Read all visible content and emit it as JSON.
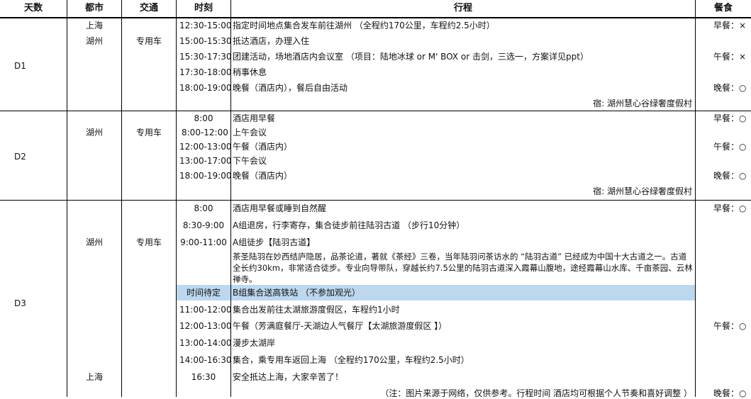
{
  "header": {
    "day": "天数",
    "city": "都市",
    "transport": "交通",
    "time": "时刻",
    "itinerary": "行程",
    "meal": "餐食"
  },
  "d1": {
    "day": "D1",
    "cities": [
      "上海",
      "湖州"
    ],
    "transport": "专用车",
    "rows": [
      {
        "time": "12:30-15:00",
        "text": "指定时间地点集合发车前往湖州 （全程约170公里，车程约2.5小时）"
      },
      {
        "time": "15:00-15:30",
        "text": "抵达酒店，办理入住"
      },
      {
        "time": "15:30-17:30",
        "text": "团建活动，场地酒店内会议室 （项目：陆地冰球 or M' BOX or 击剑，三选一，方案详见ppt）"
      },
      {
        "time": "17:30-18:00",
        "text": "稍事休息"
      },
      {
        "time": "18:00-19:00",
        "text": "晚餐（酒店内），餐后自由活动"
      }
    ],
    "stay": "宿:  湖州慧心谷绿奢度假村",
    "meals": [
      "早餐：×",
      "午餐：×",
      "晚餐：○"
    ]
  },
  "d2": {
    "day": "D2",
    "city": "湖州",
    "transport": "专用车",
    "rows": [
      {
        "time": "8:00",
        "text": "酒店用早餐"
      },
      {
        "time": "8:00-12:00",
        "text": "上午会议"
      },
      {
        "time": "12:00-13:00",
        "text": "午餐（酒店内）"
      },
      {
        "time": "13:00-17:00",
        "text": "下午会议"
      },
      {
        "time": "18:00-19:00",
        "text": "晚餐（酒店内）"
      }
    ],
    "stay": "宿:  湖州慧心谷绿奢度假村",
    "meals": [
      "早餐：○",
      "午餐：○",
      "晚餐：○"
    ]
  },
  "d3": {
    "day": "D3",
    "cities": [
      "湖州",
      "上海"
    ],
    "transport": "专用车",
    "rows": [
      {
        "time": "8:00",
        "text": "酒店用早餐或睡到自然醒"
      },
      {
        "time": "8:30-9:00",
        "text": "A组退房，行李寄存，集合徒步前往陆羽古道 （步行10分钟）"
      },
      {
        "time": "9:00-11:00",
        "text": "A组徒步【陆羽古道】"
      }
    ],
    "desc": [
      "茶圣陆羽在妙西结庐隐居，品茶论道，著就《茶经》三卷，当年陆羽问茶访水的 “陆羽古道” 已经成为中国十大古道之一。古道",
      "全长约30km，非常适合徒步。专业向导带队，穿越长约7.5公里的陆羽古道深入霞幕山腹地，途经霞幕山水库、千亩茶园、云林",
      "禅寺。"
    ],
    "highlight": {
      "time": "时间待定",
      "text": "B组集合送高铁站 （不参加观光）"
    },
    "rows2": [
      {
        "time": "11:00-12:00",
        "text": "集合出发前往太湖旅游度假区，车程约1小时"
      },
      {
        "time": "12:00-13:00",
        "text": "午餐（芳满庭餐厅-天湖边人气餐厅【太湖旅游度假区 】）"
      },
      {
        "time": "13:00-14:00",
        "text": "漫步太湖岸"
      },
      {
        "time": "14:00-16:30",
        "text": "集合，乘专用车返回上海 （全程约170公里，车程约2.5小时）"
      },
      {
        "time": "16:30",
        "text": "安全抵达上海，大家辛苦了！"
      }
    ],
    "note": "（注：图片来源于网络，仅供参考。行程时间 酒店均可根据个人节奏和喜好调整 ）",
    "meals": [
      "早餐：○",
      "午餐：○",
      "晚餐：○"
    ]
  }
}
